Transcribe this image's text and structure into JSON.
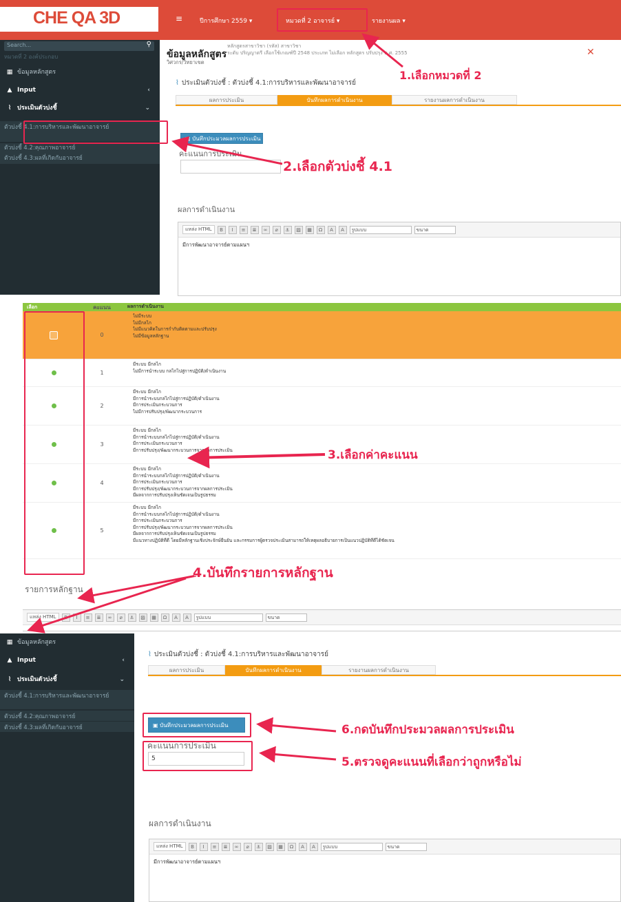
{
  "header": {
    "logo": "CHE QA 3D",
    "menu_icon": "hamburger-icon",
    "year_menu": "ปีการศึกษา 2559 ▾",
    "category_menu": "หมวดที่ 2 อาจารย์ ▾",
    "report_menu": "รายงานผล ▾",
    "bg_color": "#dd4b39"
  },
  "sidebar": {
    "search_placeholder": "Search...",
    "faded_label": "หมวดที่ 2 องค์ประกอบ",
    "items": [
      "ข้อมูลหลักสูตร",
      "Input",
      "ประเมินตัวบ่งชี้"
    ],
    "subitems": [
      "ตัวบ่งชี้ 4.1:การบริหารและพัฒนาอาจารย์",
      "ตัวบ่งชี้ 4.2:คุณภาพอาจารย์",
      "ตัวบ่งชี้ 4.3:ผลที่เกิดกับอาจารย์"
    ]
  },
  "course": {
    "title": "ข้อมูลหลักสูตร",
    "detail_line1": "หลักสูตรสาขาวิชา (รหัส) สาขาวิชา",
    "detail_line2": "ระดับ ปริญญาตรี  เลือกใช้เกณฑ์ปี 2548 ประเภท ไม่เลือก หลักสูตร ปรับปรุง พ.ศ. 2555",
    "faculty": "วิศวกร/วิทยาเขต",
    "close_icon": "close-icon"
  },
  "evaluation": {
    "heading": "ประเมินตัวบ่งชี้ : ตัวบ่งชี้ 4.1:การบริหารและพัฒนาอาจารย์",
    "tabs": [
      "ผลการประเมิน",
      "บันทึกผลการดำเนินงาน",
      "รายงานผลการดำเนินงาน"
    ],
    "save_button": "บันทึกประมวลผลการประเมิน",
    "score_label": "คะแนนการประเมิน",
    "score_value": "5",
    "result_label": "ผลการดำเนินงาน",
    "editor_source_btn": "แหล่ง HTML",
    "editor_style_select": "รูปแบบ",
    "editor_size_select": "ขนาด",
    "editor_text": "มีการพัฒนาอาจารย์ตามแผนฯ"
  },
  "rubric": {
    "headers": [
      "เลือก",
      "คะแนน",
      "ผลการดำเนินงาน"
    ],
    "rows": [
      {
        "score": "0",
        "items": [
          "ไม่มีระบบ",
          "ไม่มีกลไก",
          "ไม่มีแนวคิดในการกำกับติดตามและปรับปรุง",
          "ไม่มีข้อมูลหลักฐาน"
        ]
      },
      {
        "score": "1",
        "items": [
          "มีระบบ มีกลไก",
          "ไม่มีการนำระบบ กลไกไปสู่การปฏิบัติ/ดำเนินงาน"
        ]
      },
      {
        "score": "2",
        "items": [
          "มีระบบ มีกลไก",
          "มีการนำระบบกลไกไปสู่การปฏิบัติ/ดำเนินงาน",
          "มีการประเมินกระบวนการ",
          "ไม่มีการปรับปรุง/พัฒนากระบวนการ"
        ]
      },
      {
        "score": "3",
        "items": [
          "มีระบบ มีกลไก",
          "มีการนำระบบกลไกไปสู่การปฏิบัติ/ดำเนินงาน",
          "มีการประเมินกระบวนการ",
          "มีการปรับปรุง/พัฒนากระบวนการจากผลการประเมิน"
        ]
      },
      {
        "score": "4",
        "items": [
          "มีระบบ มีกลไก",
          "มีการนำระบบกลไกไปสู่การปฏิบัติ/ดำเนินงาน",
          "มีการประเมินกระบวนการ",
          "มีการปรับปรุง/พัฒนากระบวนการจากผลการประเมิน",
          "มีผลจากการปรับปรุงเห็นชัดเจนเป็นรูปธรรม"
        ]
      },
      {
        "score": "5",
        "items": [
          "มีระบบ มีกลไก",
          "มีการนำระบบกลไกไปสู่การปฏิบัติ/ดำเนินงาน",
          "มีการประเมินกระบวนการ",
          "มีการปรับปรุง/พัฒนากระบวนการจากผลการประเมิน",
          "มีผลจากการปรับปรุงเห็นชัดเจนเป็นรูปธรรม",
          "มีแนวทางปฏิบัติที่ดี โดยมีหลักฐานเชิงประจักษ์ยืนยัน และกรรมการผู้ตรวจประเมินสามารถให้เหตุผลอธิบายการเป็นแนวปฏิบัติที่ดีได้ชัดเจน"
        ]
      }
    ],
    "evidence_label": "รายการหลักฐาน"
  },
  "annotations": {
    "a1": "1.เลือกหมวดที่ 2",
    "a2": "2.เลือกตัวบ่งชี้ 4.1",
    "a3": "3.เลือกค่าคะแนน",
    "a4": "4.บันทึกรายการหลักฐาน",
    "a5": "5.ตรวจดูคะแนนที่เลือกว่าถูกหรือไม่",
    "a6": "6.กดบันทึกประมวลผลการประเมิน",
    "color": "#e8254f"
  }
}
